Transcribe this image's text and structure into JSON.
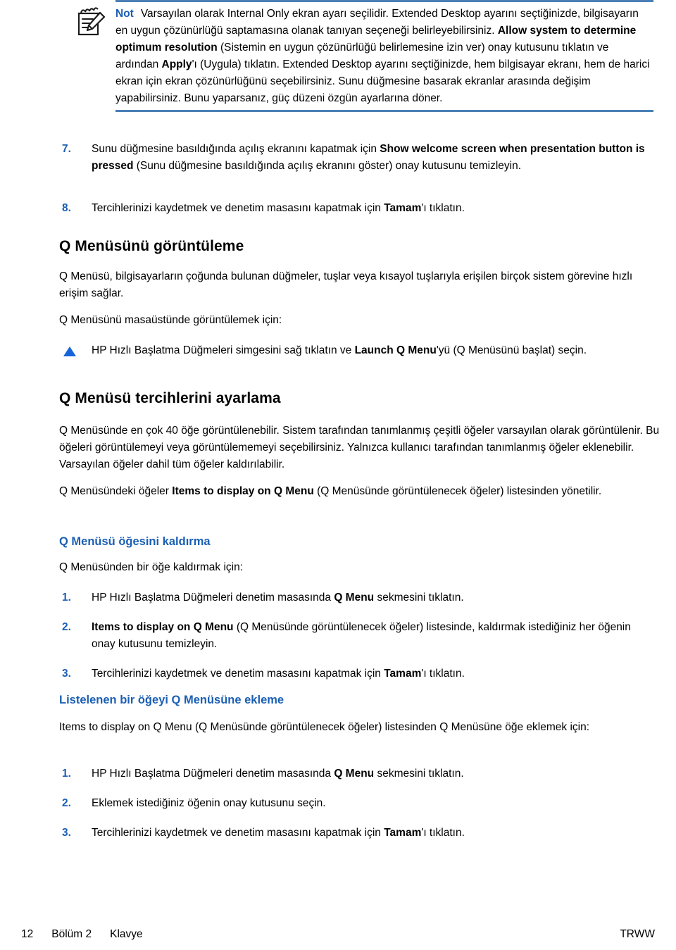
{
  "note": {
    "icon": "note-pencil-icon",
    "label": "Not",
    "rule_color": "#4a7fb5",
    "label_color": "#1a5fb4",
    "segments": [
      {
        "text": "Varsayılan olarak Internal Only ekran ayarı seçilidir. Extended Desktop ayarını seçtiğinizde, bilgisayarın en uygun çözünürlüğü saptamasına olanak tanıyan seçeneği belirleyebilirsiniz. ",
        "bold": false
      },
      {
        "text": "Allow system to determine optimum resolution",
        "bold": true
      },
      {
        "text": " (Sistemin en uygun çözünürlüğü belirlemesine izin ver) onay kutusunu tıklatın ve ardından ",
        "bold": false
      },
      {
        "text": "Apply",
        "bold": true
      },
      {
        "text": "'ı (Uygula) tıklatın. Extended Desktop ayarını seçtiğinizde, hem bilgisayar ekranı, hem de harici ekran için ekran çözünürlüğünü seçebilirsiniz. Sunu düğmesine basarak ekranlar arasında değişim yapabilirsiniz. Bunu yaparsanız, güç düzeni özgün ayarlarına döner.",
        "bold": false
      }
    ]
  },
  "steps_top": [
    {
      "number": "7.",
      "segments": [
        {
          "text": "Sunu düğmesine basıldığında açılış ekranını kapatmak için ",
          "bold": false
        },
        {
          "text": "Show welcome screen when presentation button is pressed",
          "bold": true
        },
        {
          "text": " (Sunu düğmesine basıldığında açılış ekranını göster) onay kutusunu temizleyin.",
          "bold": false
        }
      ]
    },
    {
      "number": "8.",
      "segments": [
        {
          "text": "Tercihlerinizi kaydetmek ve denetim masasını kapatmak için ",
          "bold": false
        },
        {
          "text": "Tamam",
          "bold": true
        },
        {
          "text": "'ı tıklatın.",
          "bold": false
        }
      ]
    }
  ],
  "section_view_qmenu": {
    "heading": "Q Menüsünü görüntüleme",
    "intro": "Q Menüsü, bilgisayarların çoğunda bulunan düğmeler, tuşlar veya kısayol tuşlarıyla erişilen birçok sistem görevine hızlı erişim sağlar.",
    "lead_in": "Q Menüsünü masaüstünde görüntülemek için:",
    "bullet_segments": [
      {
        "text": "HP Hızlı Başlatma Düğmeleri simgesini sağ tıklatın ve ",
        "bold": false
      },
      {
        "text": "Launch Q Menu",
        "bold": true
      },
      {
        "text": "'yü (Q Menüsünü başlat) seçin.",
        "bold": false
      }
    ]
  },
  "section_prefs": {
    "heading": "Q Menüsü tercihlerini ayarlama",
    "para1": "Q Menüsünde en çok 40 öğe görüntülenebilir. Sistem tarafından tanımlanmış çeşitli öğeler varsayılan olarak görüntülenir. Bu öğeleri görüntülemeyi veya görüntülememeyi seçebilirsiniz. Yalnızca kullanıcı tarafından tanımlanmış öğeler eklenebilir. Varsayılan öğeler dahil tüm öğeler kaldırılabilir.",
    "para2_segments": [
      {
        "text": "Q Menüsündeki öğeler ",
        "bold": false
      },
      {
        "text": "Items to display on Q Menu",
        "bold": true
      },
      {
        "text": " (Q Menüsünde görüntülenecek öğeler) listesinden yönetilir.",
        "bold": false
      }
    ]
  },
  "section_remove": {
    "heading": "Q Menüsü öğesini kaldırma",
    "lead_in": "Q Menüsünden bir öğe kaldırmak için:",
    "steps": [
      {
        "number": "1.",
        "segments": [
          {
            "text": "HP Hızlı Başlatma Düğmeleri denetim masasında ",
            "bold": false
          },
          {
            "text": "Q Menu",
            "bold": true
          },
          {
            "text": " sekmesini tıklatın.",
            "bold": false
          }
        ]
      },
      {
        "number": "2.",
        "segments": [
          {
            "text": "Items to display on Q Menu",
            "bold": true
          },
          {
            "text": " (Q Menüsünde görüntülenecek öğeler) listesinde, kaldırmak istediğiniz her öğenin onay kutusunu temizleyin.",
            "bold": false
          }
        ]
      },
      {
        "number": "3.",
        "segments": [
          {
            "text": "Tercihlerinizi kaydetmek ve denetim masasını kapatmak için ",
            "bold": false
          },
          {
            "text": "Tamam",
            "bold": true
          },
          {
            "text": "'ı tıklatın.",
            "bold": false
          }
        ]
      }
    ]
  },
  "section_add": {
    "heading": "Listelenen bir öğeyi Q Menüsüne ekleme",
    "lead_in": "Items to display on Q Menu (Q Menüsünde görüntülenecek öğeler) listesinden Q Menüsüne öğe eklemek için:",
    "steps": [
      {
        "number": "1.",
        "segments": [
          {
            "text": "HP Hızlı Başlatma Düğmeleri denetim masasında ",
            "bold": false
          },
          {
            "text": "Q Menu",
            "bold": true
          },
          {
            "text": " sekmesini tıklatın.",
            "bold": false
          }
        ]
      },
      {
        "number": "2.",
        "segments": [
          {
            "text": "Eklemek istediğiniz öğenin onay kutusunu seçin.",
            "bold": false
          }
        ]
      },
      {
        "number": "3.",
        "segments": [
          {
            "text": "Tercihlerinizi kaydetmek ve denetim masasını kapatmak için ",
            "bold": false
          },
          {
            "text": "Tamam",
            "bold": true
          },
          {
            "text": "'ı tıklatın.",
            "bold": false
          }
        ]
      }
    ]
  },
  "footer": {
    "page_number": "12",
    "chapter": "Bölüm 2",
    "section": "Klavye",
    "right": "TRWW"
  }
}
